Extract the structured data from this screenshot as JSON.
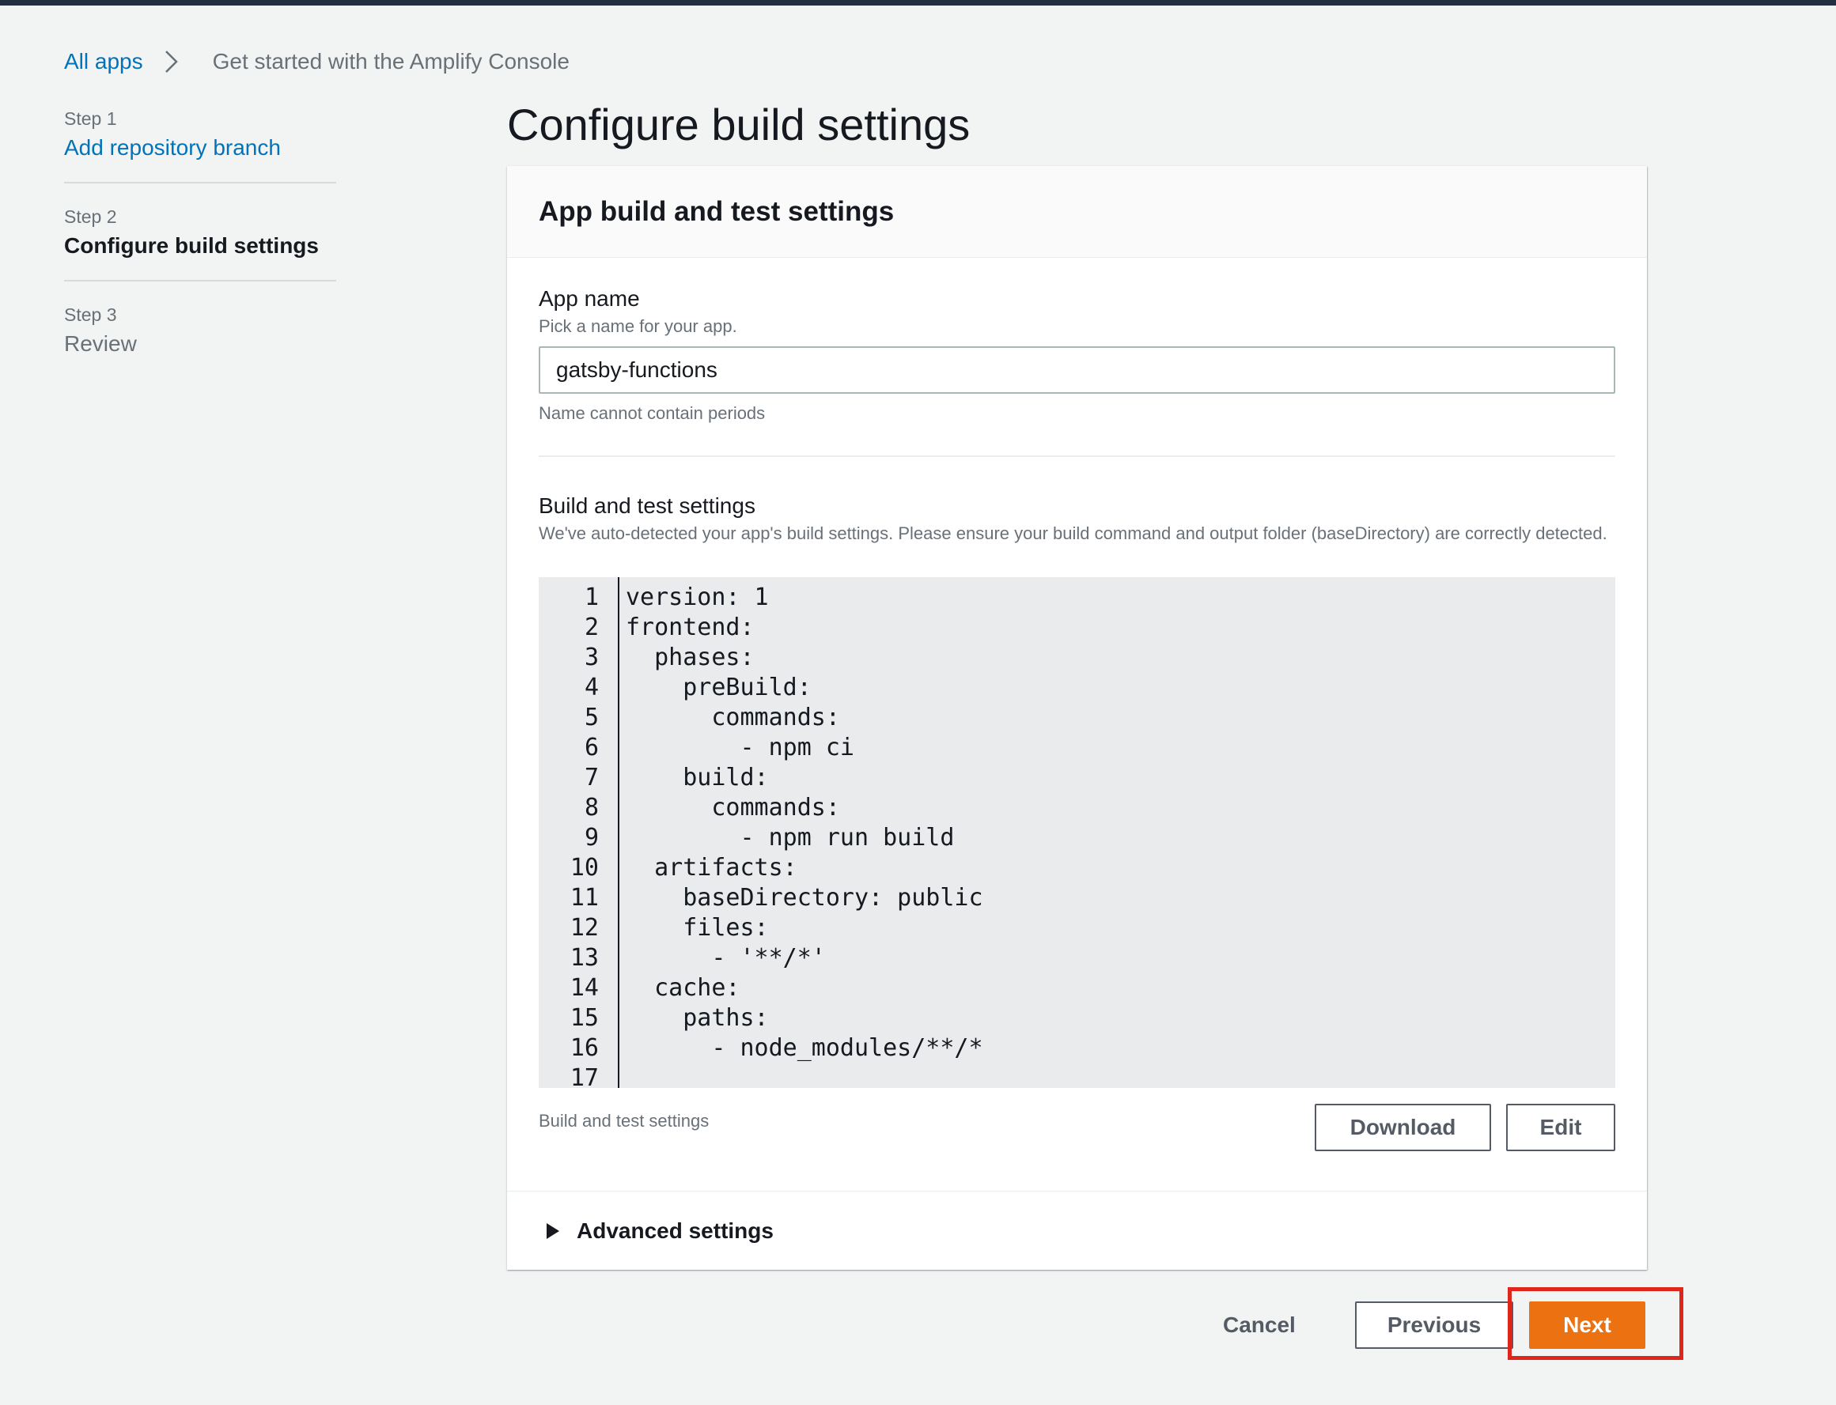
{
  "breadcrumb": {
    "all_apps": "All apps",
    "current": "Get started with the Amplify Console"
  },
  "steps": [
    {
      "num": "Step 1",
      "title": "Add repository branch",
      "state": "link"
    },
    {
      "num": "Step 2",
      "title": "Configure build settings",
      "state": "active"
    },
    {
      "num": "Step 3",
      "title": "Review",
      "state": "disabled"
    }
  ],
  "page_title": "Configure build settings",
  "panel": {
    "title": "App build and test settings",
    "app_name": {
      "label": "App name",
      "description": "Pick a name for your app.",
      "value": "gatsby-functions",
      "hint": "Name cannot contain periods"
    },
    "build_settings": {
      "label": "Build and test settings",
      "description": "We've auto-detected your app's build settings. Please ensure your build command and output folder (baseDirectory) are correctly detected.",
      "code_lines": [
        "version: 1",
        "frontend:",
        "  phases:",
        "    preBuild:",
        "      commands:",
        "        - npm ci",
        "    build:",
        "      commands:",
        "        - npm run build",
        "  artifacts:",
        "    baseDirectory: public",
        "    files:",
        "      - '**/*'",
        "  cache:",
        "    paths:",
        "      - node_modules/**/*",
        ""
      ],
      "caption": "Build and test settings",
      "download_label": "Download",
      "edit_label": "Edit"
    },
    "advanced_label": "Advanced settings"
  },
  "footer": {
    "cancel_label": "Cancel",
    "previous_label": "Previous",
    "next_label": "Next"
  },
  "colors": {
    "link": "#0073bb",
    "primary_button": "#ec7211",
    "highlight": "#e0251b",
    "topbar": "#232f3e"
  }
}
